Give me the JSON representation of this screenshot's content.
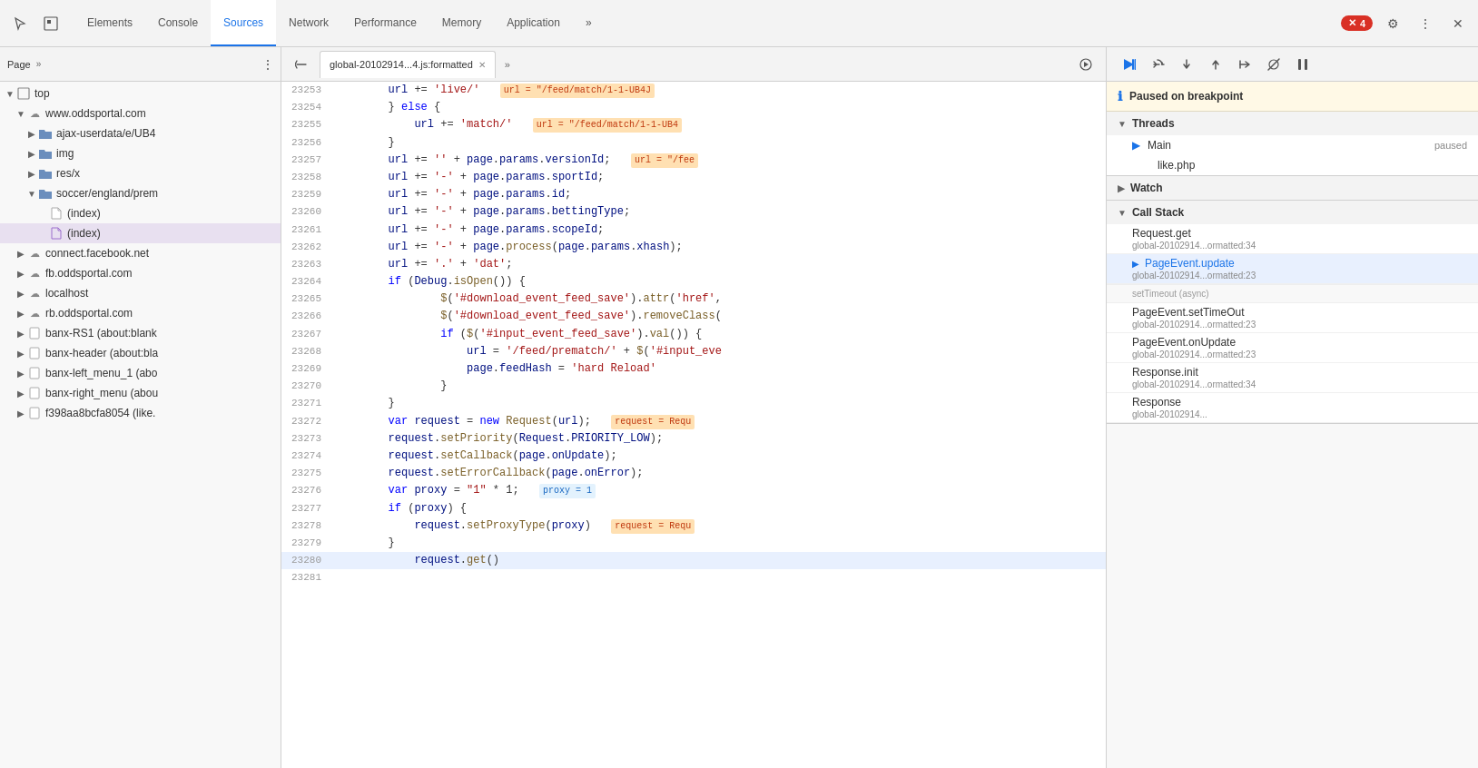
{
  "toolbar": {
    "tabs": [
      {
        "label": "Elements",
        "active": false
      },
      {
        "label": "Console",
        "active": false
      },
      {
        "label": "Sources",
        "active": true
      },
      {
        "label": "Network",
        "active": false
      },
      {
        "label": "Performance",
        "active": false
      },
      {
        "label": "Memory",
        "active": false
      },
      {
        "label": "Application",
        "active": false
      }
    ],
    "more_tabs_label": "»",
    "error_count": "4",
    "close_label": "✕"
  },
  "left_panel": {
    "header_label": "Page",
    "more_label": "»",
    "tree": [
      {
        "id": "top",
        "label": "top",
        "depth": 0,
        "type": "frame",
        "expanded": true,
        "selected": false
      },
      {
        "id": "www.oddsportal.com",
        "label": "www.oddsportal.com",
        "depth": 1,
        "type": "cloud",
        "expanded": true,
        "selected": false
      },
      {
        "id": "ajax-userdata",
        "label": "ajax-userdata/e/UB4",
        "depth": 2,
        "type": "folder",
        "expanded": false,
        "selected": false
      },
      {
        "id": "img",
        "label": "img",
        "depth": 2,
        "type": "folder",
        "expanded": false,
        "selected": false
      },
      {
        "id": "res-x",
        "label": "res/x",
        "depth": 2,
        "type": "folder",
        "expanded": false,
        "selected": false
      },
      {
        "id": "soccer-england",
        "label": "soccer/england/prem",
        "depth": 2,
        "type": "folder",
        "expanded": true,
        "selected": false
      },
      {
        "id": "index1",
        "label": "(index)",
        "depth": 3,
        "type": "file",
        "expanded": false,
        "selected": false
      },
      {
        "id": "index2",
        "label": "(index)",
        "depth": 3,
        "type": "file-purple",
        "expanded": false,
        "selected": true
      },
      {
        "id": "connect.facebook.net",
        "label": "connect.facebook.net",
        "depth": 1,
        "type": "cloud",
        "expanded": false,
        "selected": false
      },
      {
        "id": "fb.oddsportal.com",
        "label": "fb.oddsportal.com",
        "depth": 1,
        "type": "cloud",
        "expanded": false,
        "selected": false
      },
      {
        "id": "localhost",
        "label": "localhost",
        "depth": 1,
        "type": "cloud",
        "expanded": false,
        "selected": false
      },
      {
        "id": "rb.oddsportal.com",
        "label": "rb.oddsportal.com",
        "depth": 1,
        "type": "cloud",
        "expanded": false,
        "selected": false
      },
      {
        "id": "banx-RS1",
        "label": "banx-RS1 (about:blank",
        "depth": 1,
        "type": "page",
        "expanded": false,
        "selected": false
      },
      {
        "id": "banx-header",
        "label": "banx-header (about:bla",
        "depth": 1,
        "type": "page",
        "expanded": false,
        "selected": false
      },
      {
        "id": "banx-left_menu_1",
        "label": "banx-left_menu_1 (abo",
        "depth": 1,
        "type": "page",
        "expanded": false,
        "selected": false
      },
      {
        "id": "banx-right_menu",
        "label": "banx-right_menu (abou",
        "depth": 1,
        "type": "page",
        "expanded": false,
        "selected": false
      },
      {
        "id": "f398aa8bcfa8054",
        "label": "f398aa8bcfa8054 (like.",
        "depth": 1,
        "type": "page",
        "expanded": false,
        "selected": false
      }
    ]
  },
  "code_panel": {
    "file_tab_label": "global-20102914...4.js:formatted",
    "more_tabs_label": "»",
    "lines": [
      {
        "num": "23253",
        "content": "    url += 'live/'",
        "highlight": "url = \"/feed/match/1-1-UB4J",
        "type": "normal"
      },
      {
        "num": "23254",
        "content": "} else {",
        "type": "normal"
      },
      {
        "num": "23255",
        "content": "    url += 'match/'",
        "highlight": "url = \"/feed/match/1-1-UB4",
        "type": "normal"
      },
      {
        "num": "23256",
        "content": "}",
        "type": "normal"
      },
      {
        "num": "23257",
        "content": "url += '' + page.params.versionId;",
        "highlight": "url = \"/fee",
        "type": "normal"
      },
      {
        "num": "23258",
        "content": "url += '-' + page.params.sportId;",
        "type": "normal"
      },
      {
        "num": "23259",
        "content": "url += '-' + page.params.id;",
        "type": "normal"
      },
      {
        "num": "23260",
        "content": "url += '-' + page.params.bettingType;",
        "type": "normal"
      },
      {
        "num": "23261",
        "content": "url += '-' + page.params.scopeId;",
        "type": "normal"
      },
      {
        "num": "23262",
        "content": "url += '-' + page.process(page.params.xhash);",
        "type": "normal"
      },
      {
        "num": "23263",
        "content": "url += '.' + 'dat';",
        "type": "normal"
      },
      {
        "num": "23264",
        "content": "if (Debug.isOpen()) {",
        "type": "normal"
      },
      {
        "num": "23265",
        "content": "        $('#download_event_feed_save').attr('href',",
        "type": "normal"
      },
      {
        "num": "23266",
        "content": "        $('#download_event_feed_save').removeClass(",
        "type": "normal"
      },
      {
        "num": "23267",
        "content": "        if ($('#input_event_feed_save').val()) {",
        "type": "normal"
      },
      {
        "num": "23268",
        "content": "            url = '/feed/prematch/' + $('#input_eve",
        "type": "normal"
      },
      {
        "num": "23269",
        "content": "            page.feedHash = 'hard Reload'",
        "type": "normal"
      },
      {
        "num": "23270",
        "content": "        }",
        "type": "normal"
      },
      {
        "num": "23271",
        "content": "}",
        "type": "normal"
      },
      {
        "num": "23272",
        "content": "var request = new Request(url);",
        "highlight": "request = Requ",
        "type": "normal"
      },
      {
        "num": "23273",
        "content": "request.setPriority(Request.PRIORITY_LOW);",
        "type": "normal"
      },
      {
        "num": "23274",
        "content": "request.setCallback(page.onUpdate);",
        "type": "normal"
      },
      {
        "num": "23275",
        "content": "request.setErrorCallback(page.onError);",
        "type": "normal"
      },
      {
        "num": "23276",
        "content": "var proxy = \"1\" * 1;",
        "highlight": "proxy = 1",
        "type": "normal"
      },
      {
        "num": "23277",
        "content": "if (proxy) {",
        "type": "normal"
      },
      {
        "num": "23278",
        "content": "    request.setProxyType(proxy)",
        "highlight": "request = Requ",
        "type": "normal"
      },
      {
        "num": "23279",
        "content": "}",
        "type": "normal"
      },
      {
        "num": "23280",
        "content": "    request.get()",
        "type": "active"
      },
      {
        "num": "23281",
        "content": "",
        "type": "normal"
      }
    ]
  },
  "right_panel": {
    "breakpoint_message": "Paused on breakpoint",
    "sections": {
      "threads": {
        "label": "Threads",
        "expanded": true,
        "items": [
          {
            "name": "Main",
            "status": "paused",
            "active": true
          },
          {
            "name": "like.php",
            "status": "",
            "active": false
          }
        ]
      },
      "watch": {
        "label": "Watch",
        "expanded": false
      },
      "call_stack": {
        "label": "Call Stack",
        "expanded": true,
        "items": [
          {
            "fn": "Request.get",
            "file": "global-20102914...ormatted:34",
            "active": false,
            "black": true
          },
          {
            "fn": "PageEvent.update",
            "file": "global-20102914...ormatted:23",
            "active": true,
            "black": false
          },
          {
            "divider": "setTimeout (async)"
          },
          {
            "fn": "PageEvent.setTimeOut",
            "file": "global-20102914...ormatted:23",
            "active": false,
            "black": true
          },
          {
            "fn": "PageEvent.onUpdate",
            "file": "global-20102914...ormatted:23",
            "active": false,
            "black": true
          },
          {
            "fn": "Response.init",
            "file": "global-20102914...ormatted:34",
            "active": false,
            "black": true
          },
          {
            "fn": "Response",
            "file": "global-20102914...",
            "active": false,
            "black": true
          }
        ]
      }
    }
  },
  "icons": {
    "cursor": "⬡",
    "inspector": "⬜",
    "play": "▶",
    "pause": "⏸",
    "step_over": "↷",
    "step_into": "↓",
    "step_out": "↑",
    "deactivate": "⊘",
    "more_vert": "⋮",
    "triangle_right": "▶",
    "triangle_down": "▼",
    "chevron_right": "›",
    "chevron_down": "⌄"
  }
}
